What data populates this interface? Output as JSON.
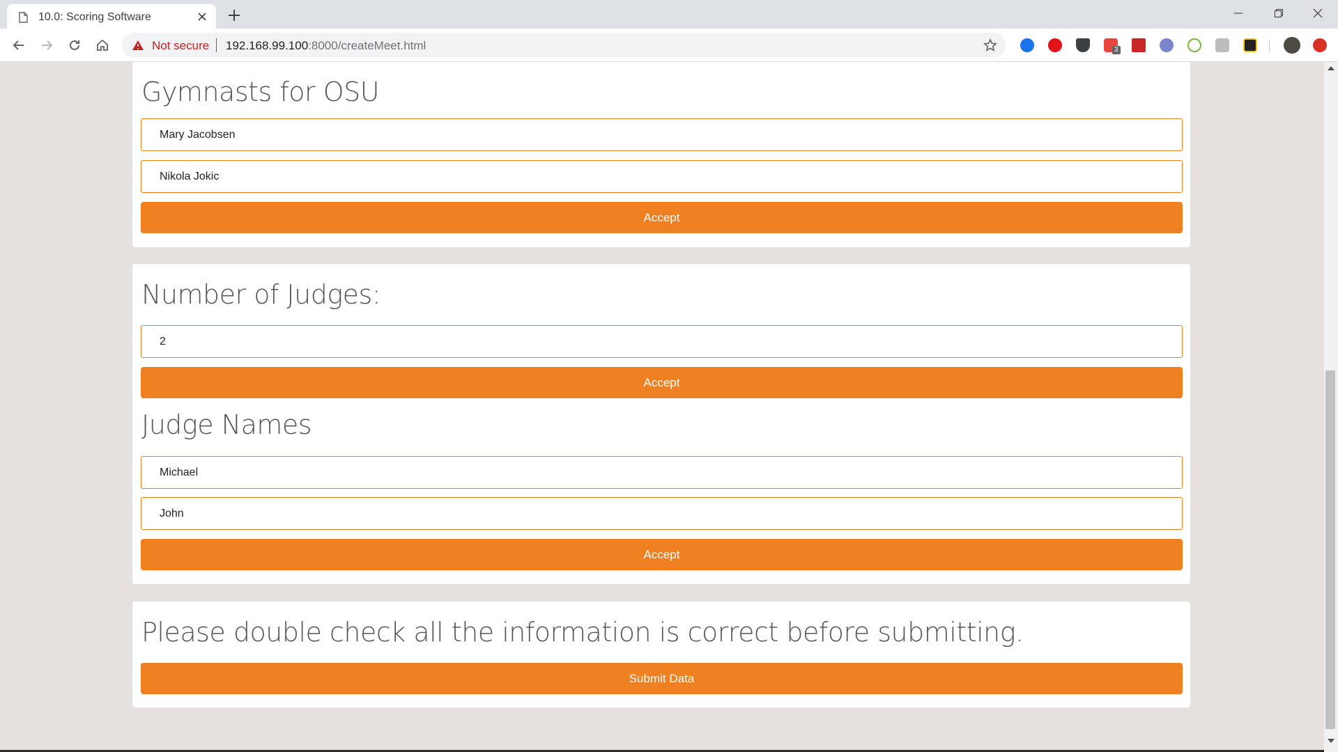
{
  "browser": {
    "tab_title": "10.0: Scoring Software",
    "security_label": "Not secure",
    "url_host": "192.168.99.100",
    "url_rest": ":8000/createMeet.html",
    "extension_badge": "3"
  },
  "gymnasts": {
    "heading": "Gymnasts for OSU",
    "names": [
      "Mary Jacobsen",
      "Nikola Jokic"
    ],
    "accept_label": "Accept"
  },
  "judges_count": {
    "heading": "Number of Judges:",
    "value": "2",
    "accept_label": "Accept"
  },
  "judge_names": {
    "heading": "Judge Names",
    "names": [
      "Michael",
      "John"
    ],
    "accept_label": "Accept"
  },
  "submit": {
    "message": "Please double check all the information is correct before submitting.",
    "button_label": "Submit Data"
  },
  "colors": {
    "accent": "#ef8021",
    "page_background": "#e4e1df"
  }
}
